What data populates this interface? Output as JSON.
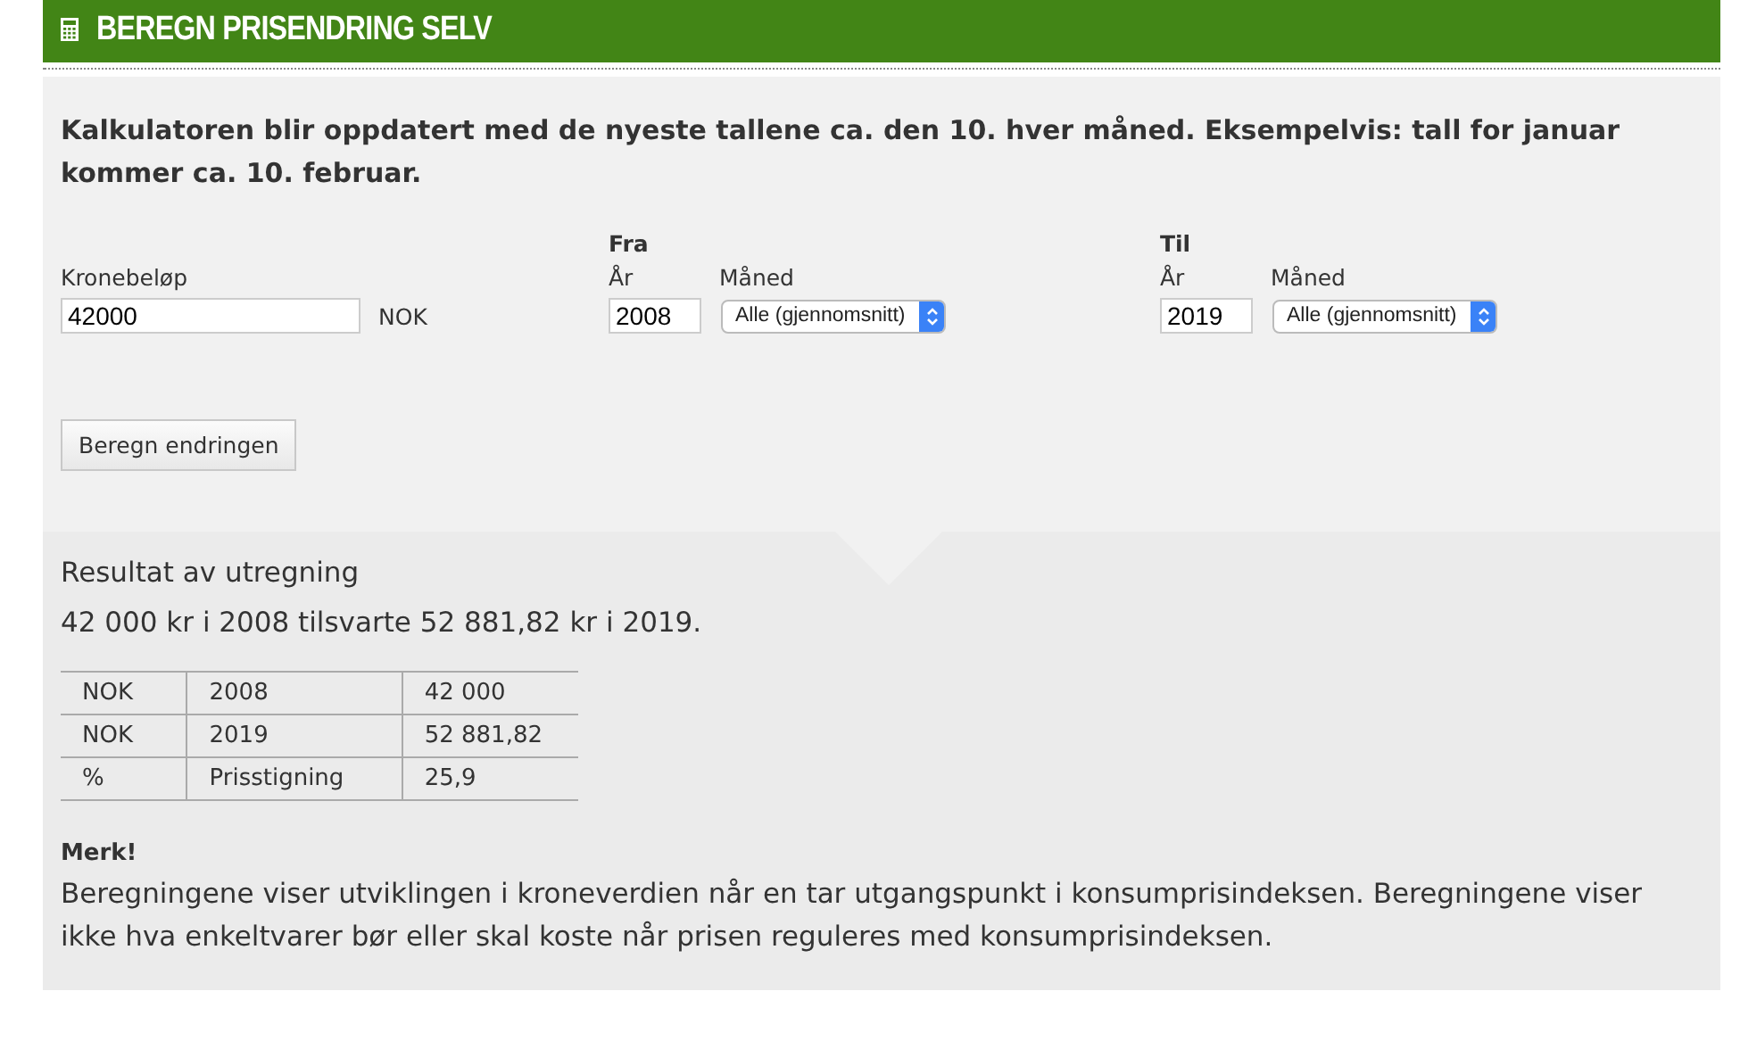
{
  "header": {
    "title": "BEREGN PRISENDRING SELV"
  },
  "intro": "Kalkulatoren blir oppdatert med de nyeste tallene ca. den 10. hver måned. Eksempelvis: tall for januar kommer ca. 10. februar.",
  "amount": {
    "label": "Kronebeløp",
    "value": "42000",
    "unit": "NOK"
  },
  "periods": [
    {
      "heading": "Fra",
      "year_label": "År",
      "year": "2008",
      "month_label": "Måned",
      "month": "Alle (gjennomsnitt)"
    },
    {
      "heading": "Til",
      "year_label": "År",
      "year": "2019",
      "month_label": "Måned",
      "month": "Alle (gjennomsnitt)"
    }
  ],
  "button": "Beregn endringen",
  "result": {
    "title": "Resultat av utregning",
    "summary": "42 000 kr i 2008 tilsvarte 52 881,82 kr i 2019.",
    "rows": [
      [
        "NOK",
        "2008",
        "42 000"
      ],
      [
        "NOK",
        "2019",
        "52 881,82"
      ],
      [
        "%",
        "Prisstigning",
        "25,9"
      ]
    ]
  },
  "note": {
    "title": "Merk!",
    "text": "Beregningene viser utviklingen i kroneverdien når en tar utgangspunkt i konsumprisindeksen. Beregningene viser ikke hva enkeltvarer bør eller skal koste når prisen reguleres med konsumprisindeksen."
  }
}
